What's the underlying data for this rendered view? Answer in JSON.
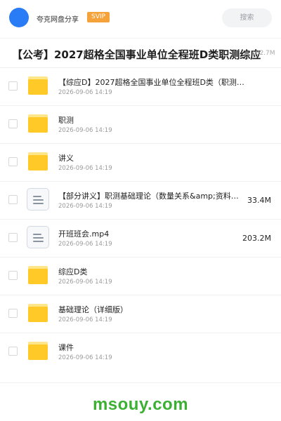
{
  "header": {
    "owner_name": "夸克网盘分享",
    "badge": "SVIP",
    "search_placeholder": "搜索"
  },
  "share": {
    "title": "【公考】2027超格全国事业单位全程班D类职测综应",
    "total_size": "182.7M"
  },
  "files": [
    {
      "type": "folder",
      "name": "【综应D】2027超格全国事业单位全程班D类（职测…",
      "date": "2026-09-06 14:19",
      "size": ""
    },
    {
      "type": "folder",
      "name": "职测",
      "date": "2026-09-06 14:19",
      "size": ""
    },
    {
      "type": "folder",
      "name": "讲义",
      "date": "2026-09-06 14:19",
      "size": ""
    },
    {
      "type": "file",
      "name": "【部分讲义】职测基础理论（数量关系&amp;资料分…",
      "date": "2026-09-06 14:19",
      "size": "33.4M"
    },
    {
      "type": "file",
      "name": "开班班会.mp4",
      "date": "2026-09-06 14:19",
      "size": "203.2M"
    },
    {
      "type": "folder",
      "name": "综应D类",
      "date": "2026-09-06 14:19",
      "size": ""
    },
    {
      "type": "folder",
      "name": "基础理论（详细版）",
      "date": "2026-09-06 14:19",
      "size": ""
    },
    {
      "type": "folder",
      "name": "课件",
      "date": "2026-09-06 14:19",
      "size": ""
    }
  ],
  "watermark": "msouy.com",
  "colors": {
    "avatar": "#2a7bf6",
    "svip_badge": "#f6a23b",
    "folder": "#ffc927",
    "watermark": "#3cb033"
  }
}
